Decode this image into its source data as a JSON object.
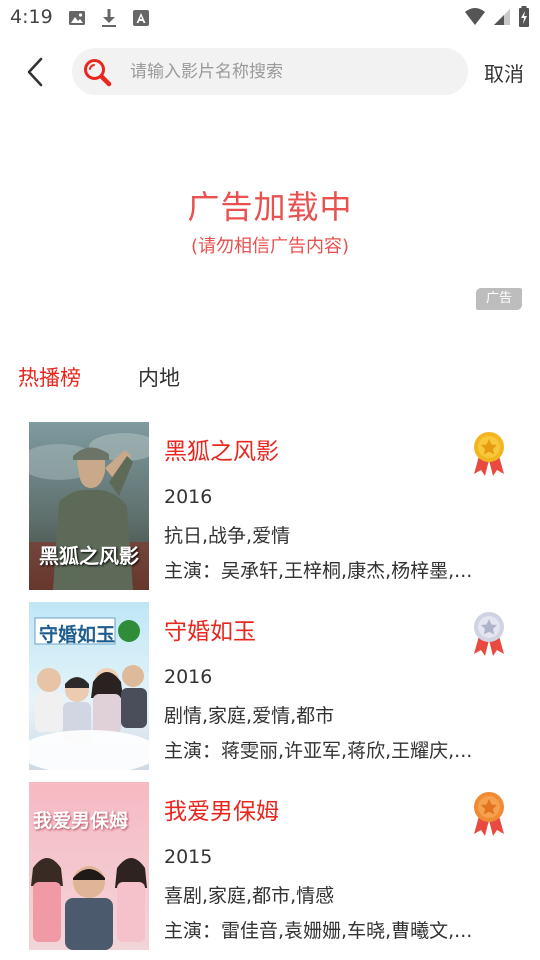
{
  "status_bar": {
    "time": "4:19"
  },
  "search": {
    "placeholder": "请输入影片名称搜索",
    "cancel_label": "取消"
  },
  "ad": {
    "title": "广告加载中",
    "subtitle": "(请勿相信广告内容)",
    "badge": "广告"
  },
  "tabs": [
    {
      "label": "热播榜",
      "active": true
    },
    {
      "label": "内地",
      "active": false
    }
  ],
  "movies": [
    {
      "title": "黑狐之风影",
      "year": "2016",
      "genres": "抗日,战争,爱情",
      "cast": "主演：吴承轩,王梓桐,康杰,杨梓墨,...",
      "poster_text": "黑狐之风影",
      "medal": "gold"
    },
    {
      "title": "守婚如玉",
      "year": "2016",
      "genres": "剧情,家庭,爱情,都市",
      "cast": "主演：蒋雯丽,许亚军,蒋欣,王耀庆,...",
      "poster_text": "守婚如玉",
      "medal": "silver"
    },
    {
      "title": "我爱男保姆",
      "year": "2015",
      "genres": "喜剧,家庭,都市,情感",
      "cast": "主演：雷佳音,袁姗姗,车晓,曹曦文,...",
      "poster_text": "我爱男保姆",
      "medal": "bronze"
    }
  ],
  "colors": {
    "accent_red": "#e8271f",
    "ad_red": "#e8514f",
    "gold": "#f2b41f",
    "silver": "#cfd3e3",
    "bronze": "#f08a33",
    "ribbon": "#e84a3f"
  }
}
